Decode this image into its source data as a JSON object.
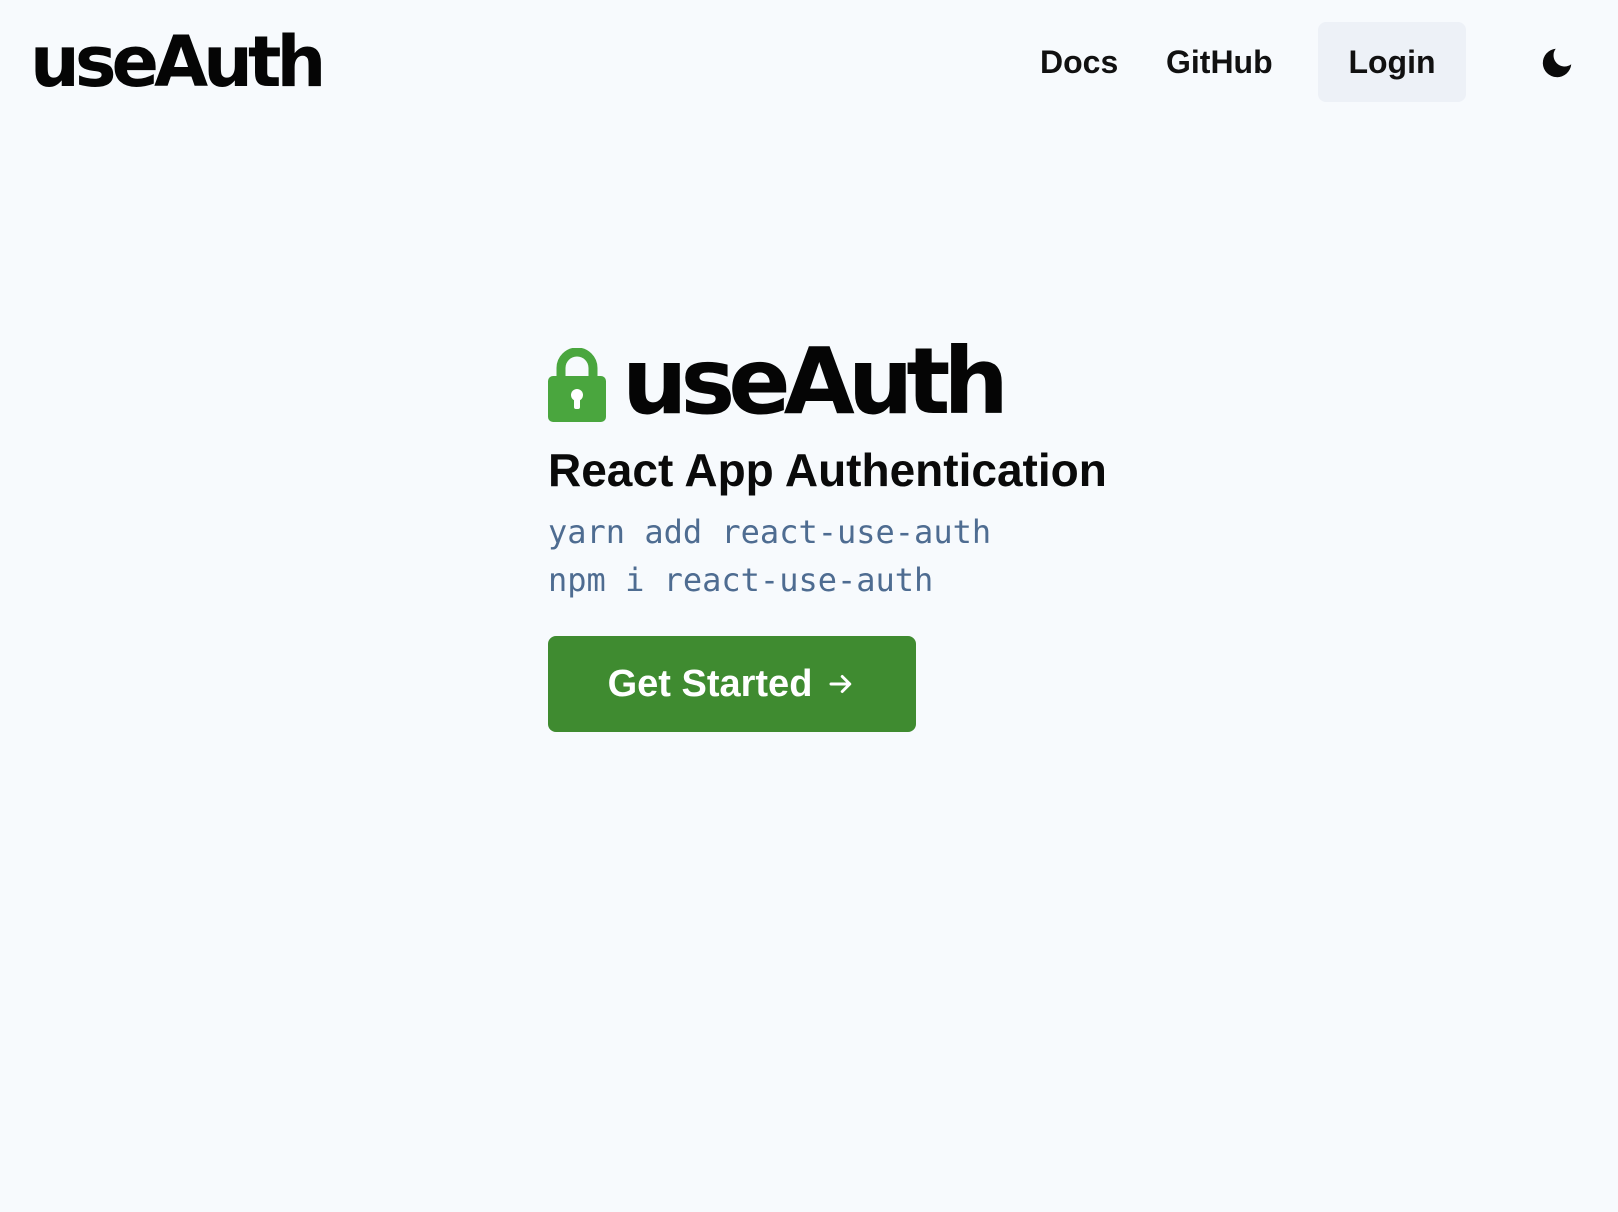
{
  "header": {
    "brand": "useAuth",
    "nav": {
      "docs_label": "Docs",
      "github_label": "GitHub"
    },
    "login_label": "Login",
    "theme_toggle_icon": "moon-icon"
  },
  "hero": {
    "logo_icon": "lock-icon",
    "title": "useAuth",
    "subtitle": "React App Authentication",
    "install_commands": [
      "yarn add react-use-auth",
      "npm i react-use-auth"
    ],
    "cta_label": "Get Started",
    "cta_icon": "arrow-right-icon"
  },
  "colors": {
    "background": "#f7fafd",
    "accent_green": "#3f8b30",
    "lock_green": "#4aa63e",
    "login_bg": "#edf1f7",
    "code_text": "#4e6c91"
  }
}
